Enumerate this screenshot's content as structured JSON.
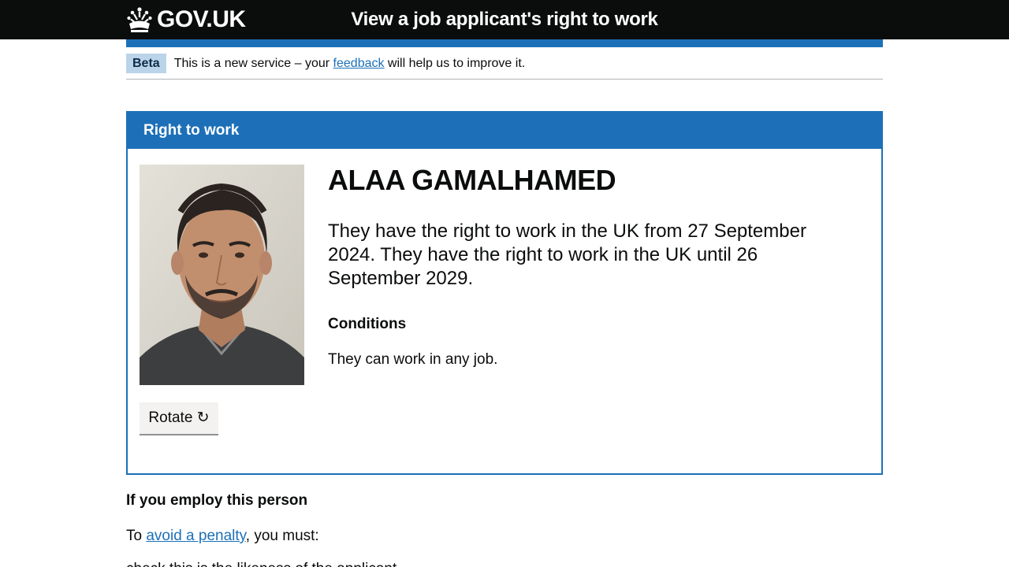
{
  "header": {
    "logo_text": "GOV.UK",
    "service_name": "View a job applicant's right to work"
  },
  "phase_banner": {
    "tag": "Beta",
    "text_before": "This is a new service – your ",
    "link": "feedback",
    "text_after": " will help us to improve it."
  },
  "panel": {
    "title": "Right to work",
    "name": "ALAA GAMALHAMED",
    "rtw_statement": "They have the right to work in the UK from 27 September 2024. They have the right to work in the UK until 26 September 2029.",
    "conditions_heading": "Conditions",
    "conditions_text": "They can work in any job.",
    "rotate_button": "Rotate ↻"
  },
  "employ": {
    "heading": "If you employ this person",
    "text_before": "To ",
    "link": "avoid a penalty",
    "text_after": ", you must:",
    "cut_off_line": "check this is the likeness of the applicant"
  },
  "colors": {
    "header_bg": "#0b0c0c",
    "brand_blue": "#1d70b8",
    "beta_tag_bg": "#bbd4ea",
    "button_bg": "#f3f2f1"
  }
}
